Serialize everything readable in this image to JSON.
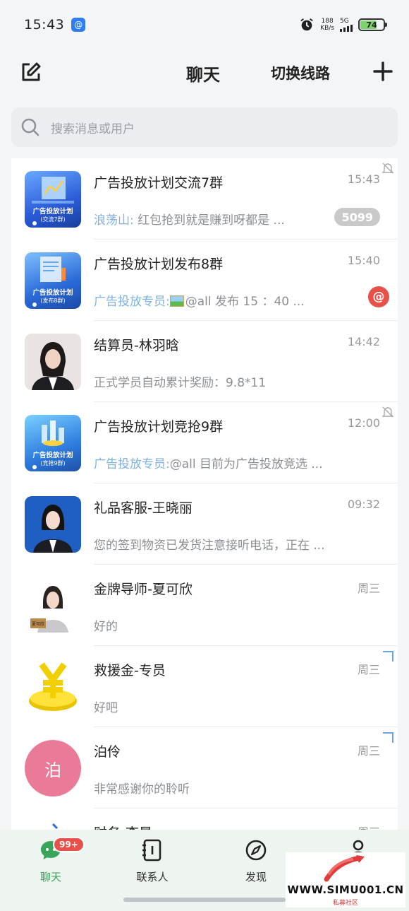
{
  "status_bar": {
    "time": "15:43",
    "net_speed_value": "188",
    "net_speed_unit": "KB/s",
    "network": "5G",
    "battery": "74",
    "battery_level": 0.74
  },
  "header": {
    "title": "聊天",
    "switch_line": "切换线路"
  },
  "search": {
    "placeholder": "搜索消息或用户"
  },
  "chats": [
    {
      "name": "广告投放计划交流7群",
      "time": "15:43",
      "sender": "浪荡山:",
      "message": " 红包抢到就是赚到呀都是 ...",
      "badge": "5099",
      "muted": true,
      "avatar_line1": "广告投放计划",
      "avatar_line2": "(交流7群)"
    },
    {
      "name": "广告投放计划发布8群",
      "time": "15:40",
      "sender": "广告投放专员:",
      "message": "@all 发布 15 ：40 ...",
      "at_badge": "@",
      "avatar_line1": "广告投放计划",
      "avatar_line2": "(发布8群)"
    },
    {
      "name": "结算员-林羽晗",
      "time": "14:42",
      "message": "正式学员自动累计奖励：9.8*11"
    },
    {
      "name": "广告投放计划竞抢9群",
      "time": "12:00",
      "sender": "广告投放专员:",
      "message": "@all 目前为广告投放竞选 ...",
      "muted": true,
      "avatar_line1": "广告投放计划",
      "avatar_line2": "(竞抢9群)"
    },
    {
      "name": "礼品客服-王晓丽",
      "time": "09:32",
      "message": "您的签到物资已发货注意接听电话，正在 ..."
    },
    {
      "name": "金牌导师-夏可欣",
      "time": "周三",
      "message": "好的",
      "avatar_tag": "夏可欣"
    },
    {
      "name": "救援金-专员",
      "time": "周三",
      "message": "好吧"
    },
    {
      "name": "泊伶",
      "time": "周三",
      "message": "非常感谢你的聆听",
      "avatar_text": "泊",
      "avatar_color": "#ea7b98"
    },
    {
      "name": "财务-李昊",
      "time": "周三",
      "message": ""
    }
  ],
  "tabs": [
    {
      "label": "聊天",
      "badge": "99+"
    },
    {
      "label": "联系人"
    },
    {
      "label": "发现"
    },
    {
      "label": "我"
    }
  ],
  "watermark": {
    "text": "WWW.SIMU001.CN",
    "sub": "私募社区"
  },
  "colors": {
    "accent_green": "#3aa55a",
    "badge_red": "#e8504a",
    "sender_blue": "#7fb2e1"
  }
}
